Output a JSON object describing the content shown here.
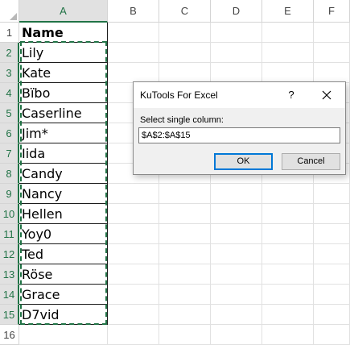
{
  "columns": [
    "A",
    "B",
    "C",
    "D",
    "E",
    "F"
  ],
  "selected_column": "A",
  "rows": [
    "1",
    "2",
    "3",
    "4",
    "5",
    "6",
    "7",
    "8",
    "9",
    "10",
    "11",
    "12",
    "13",
    "14",
    "15",
    "16"
  ],
  "column_a": [
    "Name",
    "Lily",
    "Kate",
    "Bïbo",
    "Caserline",
    "Jim*",
    "Iida",
    "Candy",
    "Nancy",
    "Hellen",
    "Yoy0",
    "Ted",
    "Röse",
    "Grace",
    "D7vid"
  ],
  "dialog": {
    "title": "KuTools For Excel",
    "help_label": "?",
    "prompt": "Select single column:",
    "range_value": "$A$2:$A$15",
    "ok_label": "OK",
    "cancel_label": "Cancel"
  },
  "colors": {
    "selection_green": "#217346",
    "ok_border": "#0078d7"
  }
}
